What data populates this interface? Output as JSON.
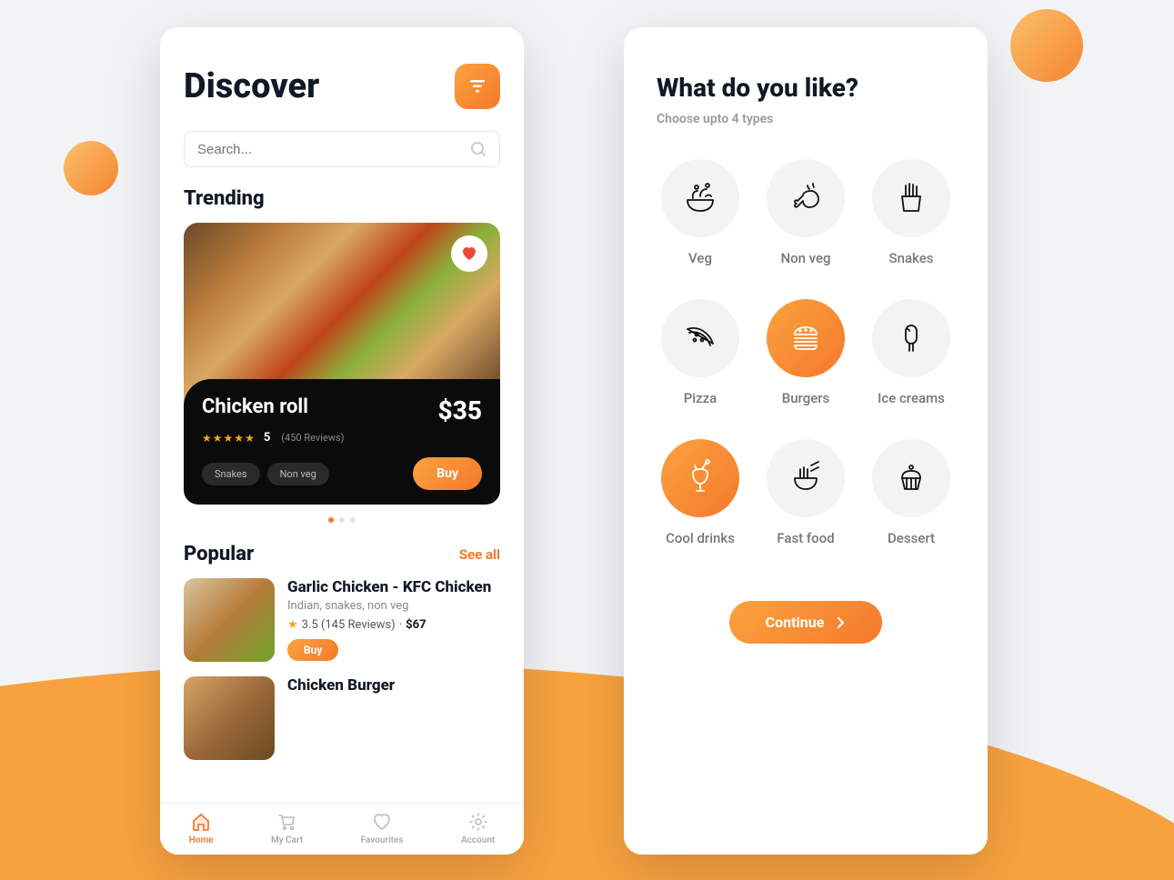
{
  "screen1": {
    "title": "Discover",
    "search_placeholder": "Search...",
    "trending_title": "Trending",
    "card": {
      "name": "Chicken roll",
      "price": "$35",
      "rating": "5",
      "reviews": "(450 Reviews)",
      "tags": [
        "Snakes",
        "Non veg"
      ],
      "buy": "Buy"
    },
    "popular_title": "Popular",
    "see_all": "See all",
    "items": [
      {
        "title": "Garlic Chicken - KFC Chicken",
        "sub": "Indian, snakes, non veg",
        "rating": "3.5 (145 Reviews)",
        "price": "$67",
        "buy": "Buy"
      },
      {
        "title": "Chicken Burger"
      }
    ],
    "nav": [
      {
        "label": "Home"
      },
      {
        "label": "My Cart"
      },
      {
        "label": "Favourites"
      },
      {
        "label": "Account"
      }
    ]
  },
  "screen2": {
    "title": "What do you like?",
    "sub": "Choose upto 4 types",
    "types": [
      {
        "label": "Veg"
      },
      {
        "label": "Non veg"
      },
      {
        "label": "Snakes"
      },
      {
        "label": "Pizza"
      },
      {
        "label": "Burgers"
      },
      {
        "label": "Ice creams"
      },
      {
        "label": "Cool drinks"
      },
      {
        "label": "Fast food"
      },
      {
        "label": "Dessert"
      }
    ],
    "continue": "Continue"
  }
}
